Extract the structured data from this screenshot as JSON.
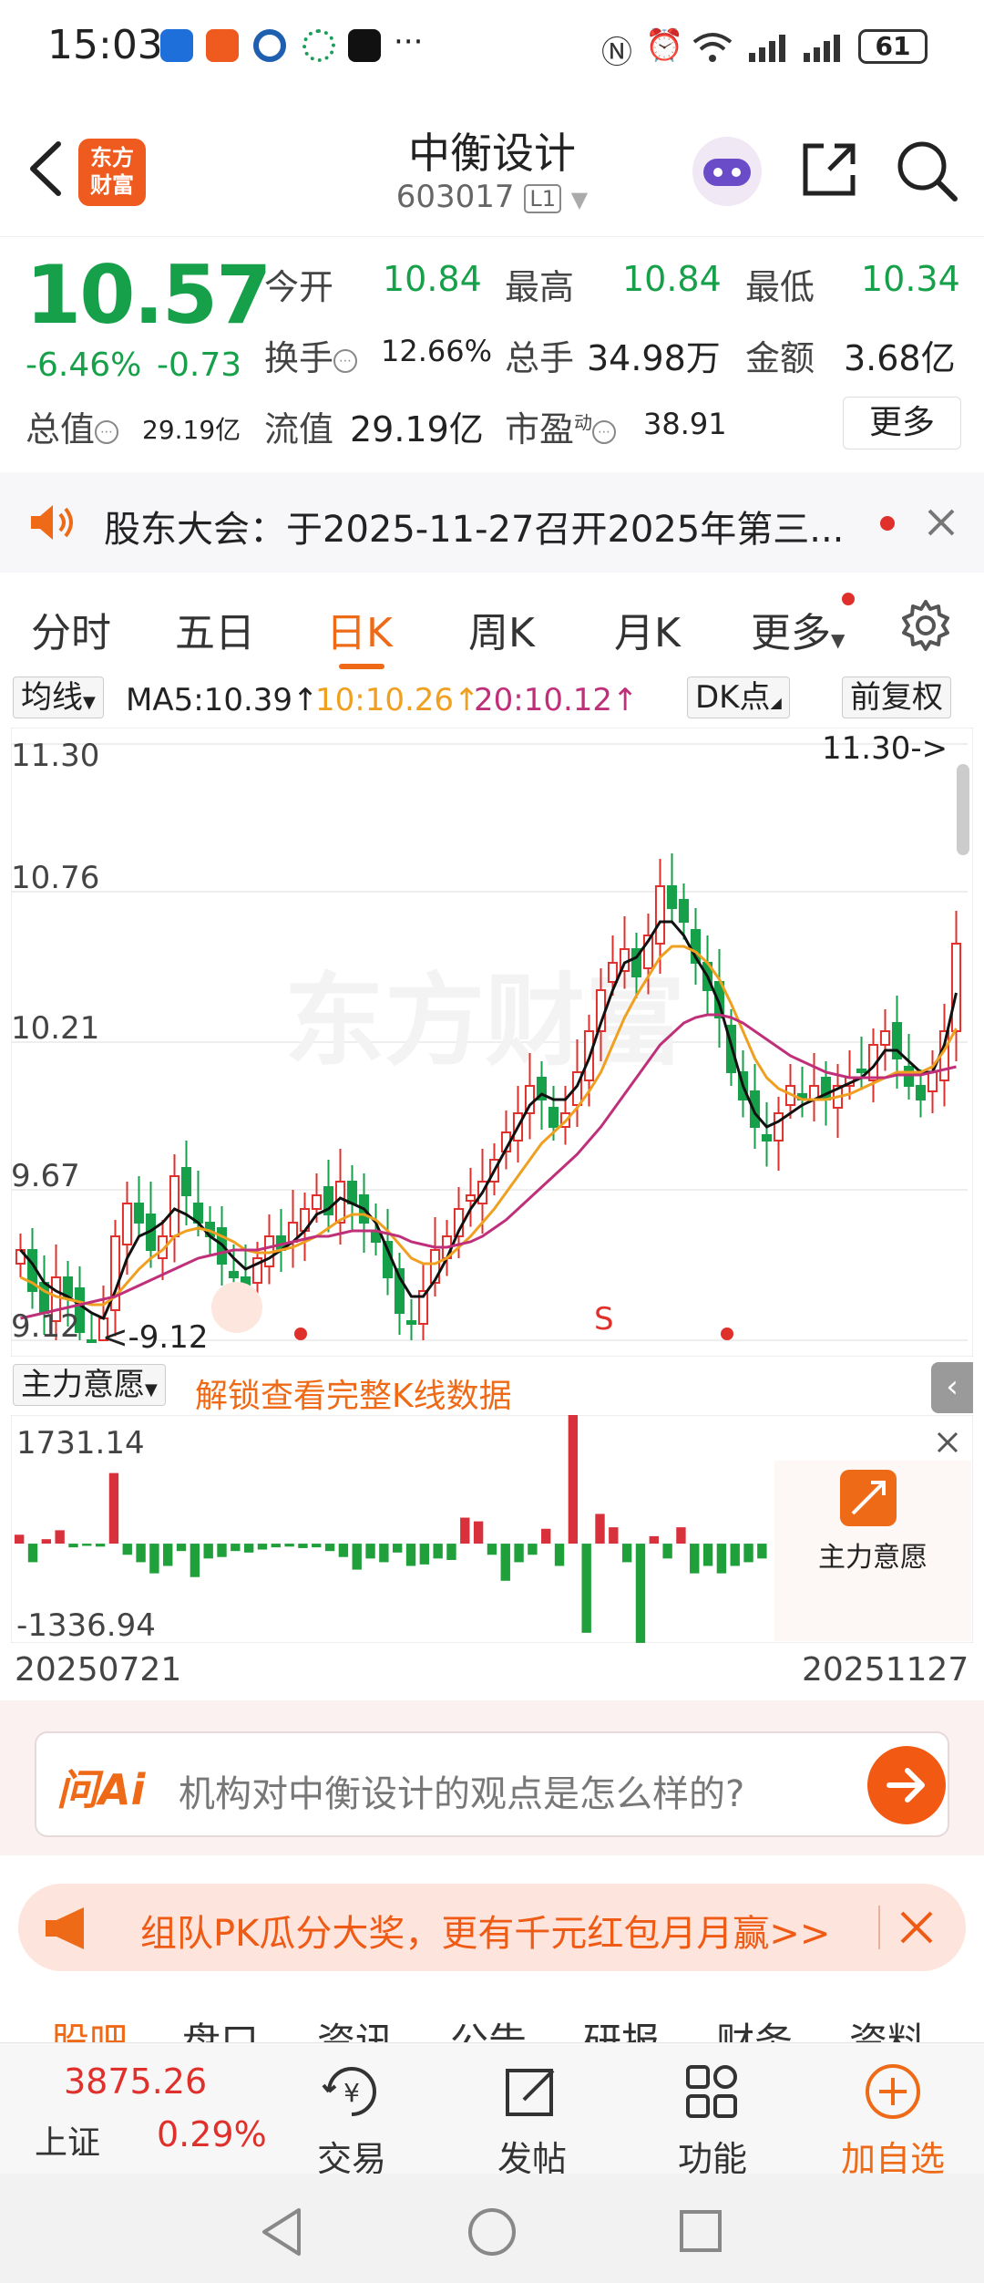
{
  "status_bar": {
    "time": "15:03",
    "more": "···",
    "battery": "61"
  },
  "header": {
    "logo_text": "东方财富",
    "name": "中衡设计",
    "code": "603017",
    "level": "L1"
  },
  "quote": {
    "price": "10.57",
    "change_pct": "-6.46%",
    "change_abs": "-0.73",
    "open_label": "今开",
    "open": "10.84",
    "high_label": "最高",
    "high": "10.84",
    "low_label": "最低",
    "low": "10.34",
    "turnover_label": "换手",
    "turnover": "12.66%",
    "volume_label": "总手",
    "volume": "34.98万",
    "amount_label": "金额",
    "amount": "3.68亿",
    "mktcap_label": "总值",
    "mktcap": "29.19亿",
    "float_label": "流值",
    "float": "29.19亿",
    "pe_label": "市盈",
    "pe_sup": "动",
    "pe": "38.91",
    "more_label": "更多"
  },
  "notice": {
    "text": "股东大会：于2025-11-27召开2025年第三..."
  },
  "tabs": [
    "分时",
    "五日",
    "日K",
    "周K",
    "月K",
    "更多"
  ],
  "active_tab": "日K",
  "ma_row": {
    "selector": "均线",
    "ma5": "MA5:10.39↑",
    "ma10": "10:10.26↑",
    "ma20": "20:10.12↑",
    "dk": "DK点",
    "adjust": "前复权"
  },
  "colors": {
    "up": "#e0302b",
    "down": "#17a04a",
    "ma5": "#111111",
    "ma10": "#f0a020",
    "ma20": "#c0307a",
    "accent": "#ef6a17"
  },
  "chart_data": {
    "type": "candlestick",
    "y_ticks": [
      "11.30",
      "10.76",
      "10.21",
      "9.67",
      "9.12"
    ],
    "ylim": [
      9.12,
      11.3
    ],
    "max_marker": "11.30->",
    "min_marker": "<-9.12",
    "signal_label": "S",
    "watermark": "东方财富",
    "closes": [
      9.45,
      9.3,
      9.22,
      9.35,
      9.28,
      9.15,
      9.12,
      9.2,
      9.5,
      9.62,
      9.55,
      9.45,
      9.5,
      9.72,
      9.65,
      9.55,
      9.5,
      9.4,
      9.35,
      9.3,
      9.42,
      9.5,
      9.45,
      9.55,
      9.6,
      9.65,
      9.58,
      9.7,
      9.62,
      9.55,
      9.48,
      9.35,
      9.22,
      9.18,
      9.3,
      9.45,
      9.5,
      9.6,
      9.65,
      9.7,
      9.78,
      9.88,
      9.95,
      10.05,
      10.0,
      9.9,
      9.95,
      10.1,
      10.25,
      10.4,
      10.5,
      10.55,
      10.45,
      10.6,
      10.78,
      10.7,
      10.65,
      10.5,
      10.4,
      10.3,
      10.1,
      10.0,
      9.9,
      9.85,
      9.95,
      10.05,
      10.0,
      10.05,
      10.0,
      10.05,
      10.08,
      10.1,
      10.2,
      10.25,
      10.15,
      10.05,
      10.0,
      10.1,
      10.25,
      10.57
    ],
    "ma5": [
      9.45,
      9.4,
      9.33,
      9.3,
      9.28,
      9.25,
      9.22,
      9.2,
      9.3,
      9.42,
      9.5,
      9.52,
      9.55,
      9.6,
      9.58,
      9.55,
      9.5,
      9.47,
      9.42,
      9.38,
      9.4,
      9.42,
      9.45,
      9.48,
      9.52,
      9.58,
      9.6,
      9.64,
      9.62,
      9.6,
      9.55,
      9.45,
      9.35,
      9.28,
      9.28,
      9.34,
      9.42,
      9.52,
      9.6,
      9.66,
      9.74,
      9.82,
      9.9,
      9.98,
      10.02,
      10.0,
      10.0,
      10.05,
      10.15,
      10.28,
      10.4,
      10.5,
      10.52,
      10.58,
      10.65,
      10.65,
      10.6,
      10.52,
      10.45,
      10.35,
      10.2,
      10.05,
      9.95,
      9.9,
      9.92,
      9.95,
      9.98,
      10.0,
      10.02,
      10.04,
      10.06,
      10.08,
      10.12,
      10.18,
      10.18,
      10.14,
      10.1,
      10.1,
      10.2,
      10.39
    ],
    "ma10": [
      9.35,
      9.33,
      9.3,
      9.28,
      9.27,
      9.26,
      9.25,
      9.25,
      9.28,
      9.33,
      9.38,
      9.42,
      9.45,
      9.5,
      9.52,
      9.53,
      9.52,
      9.5,
      9.48,
      9.45,
      9.44,
      9.44,
      9.45,
      9.46,
      9.48,
      9.5,
      9.53,
      9.56,
      9.58,
      9.58,
      9.56,
      9.52,
      9.47,
      9.42,
      9.4,
      9.4,
      9.42,
      9.46,
      9.5,
      9.55,
      9.6,
      9.66,
      9.72,
      9.78,
      9.84,
      9.88,
      9.92,
      9.97,
      10.03,
      10.1,
      10.2,
      10.3,
      10.38,
      10.45,
      10.52,
      10.56,
      10.56,
      10.54,
      10.5,
      10.44,
      10.35,
      10.25,
      10.15,
      10.08,
      10.04,
      10.02,
      10.0,
      10.0,
      10.0,
      10.01,
      10.02,
      10.04,
      10.06,
      10.08,
      10.1,
      10.1,
      10.1,
      10.12,
      10.18,
      10.26
    ],
    "ma20": [
      9.2,
      9.21,
      9.22,
      9.23,
      9.24,
      9.25,
      9.26,
      9.27,
      9.28,
      9.3,
      9.32,
      9.34,
      9.36,
      9.38,
      9.4,
      9.42,
      9.43,
      9.44,
      9.45,
      9.45,
      9.45,
      9.46,
      9.47,
      9.48,
      9.49,
      9.5,
      9.5,
      9.51,
      9.52,
      9.52,
      9.52,
      9.51,
      9.5,
      9.48,
      9.47,
      9.46,
      9.46,
      9.47,
      9.48,
      9.5,
      9.53,
      9.56,
      9.6,
      9.64,
      9.68,
      9.72,
      9.76,
      9.8,
      9.85,
      9.9,
      9.96,
      10.02,
      10.08,
      10.14,
      10.2,
      10.24,
      10.28,
      10.3,
      10.31,
      10.31,
      10.3,
      10.28,
      10.25,
      10.22,
      10.19,
      10.16,
      10.14,
      10.12,
      10.1,
      10.09,
      10.08,
      10.08,
      10.08,
      10.08,
      10.09,
      10.09,
      10.09,
      10.1,
      10.11,
      10.12
    ]
  },
  "indicator": {
    "selector": "主力意愿",
    "unlock": "解锁查看完整K线数据",
    "ymax": "1731.14",
    "ymin": "-1336.94",
    "panel_label": "主力意愿",
    "bars": [
      120,
      -250,
      60,
      180,
      -50,
      -30,
      -40,
      950,
      -150,
      -250,
      -400,
      -300,
      -100,
      -450,
      -200,
      -180,
      -100,
      -120,
      -80,
      -50,
      -40,
      -60,
      -50,
      -100,
      -180,
      -350,
      -200,
      -250,
      -120,
      -300,
      -280,
      -200,
      -220,
      350,
      300,
      -150,
      -500,
      -250,
      -150,
      200,
      -300,
      1731,
      -1200,
      400,
      220,
      -250,
      -1336,
      100,
      -200,
      220,
      -400,
      -300,
      -400,
      -300,
      -250,
      -200
    ]
  },
  "dates": {
    "start": "20250721",
    "end": "20251127"
  },
  "ai": {
    "logo": "问Ai",
    "placeholder": "机构对中衡设计的观点是怎么样的?"
  },
  "promo": {
    "text": "组队PK瓜分大奖，更有千元红包月月赢>>"
  },
  "sub_tabs": [
    "股吧",
    "盘口",
    "资讯",
    "公告",
    "研报",
    "财务",
    "资料"
  ],
  "bottom_bar": {
    "index_value": "3875.26",
    "index_name": "上证",
    "index_pct": "0.29%",
    "trade": "交易",
    "post": "发帖",
    "function": "功能",
    "add": "加自选"
  }
}
